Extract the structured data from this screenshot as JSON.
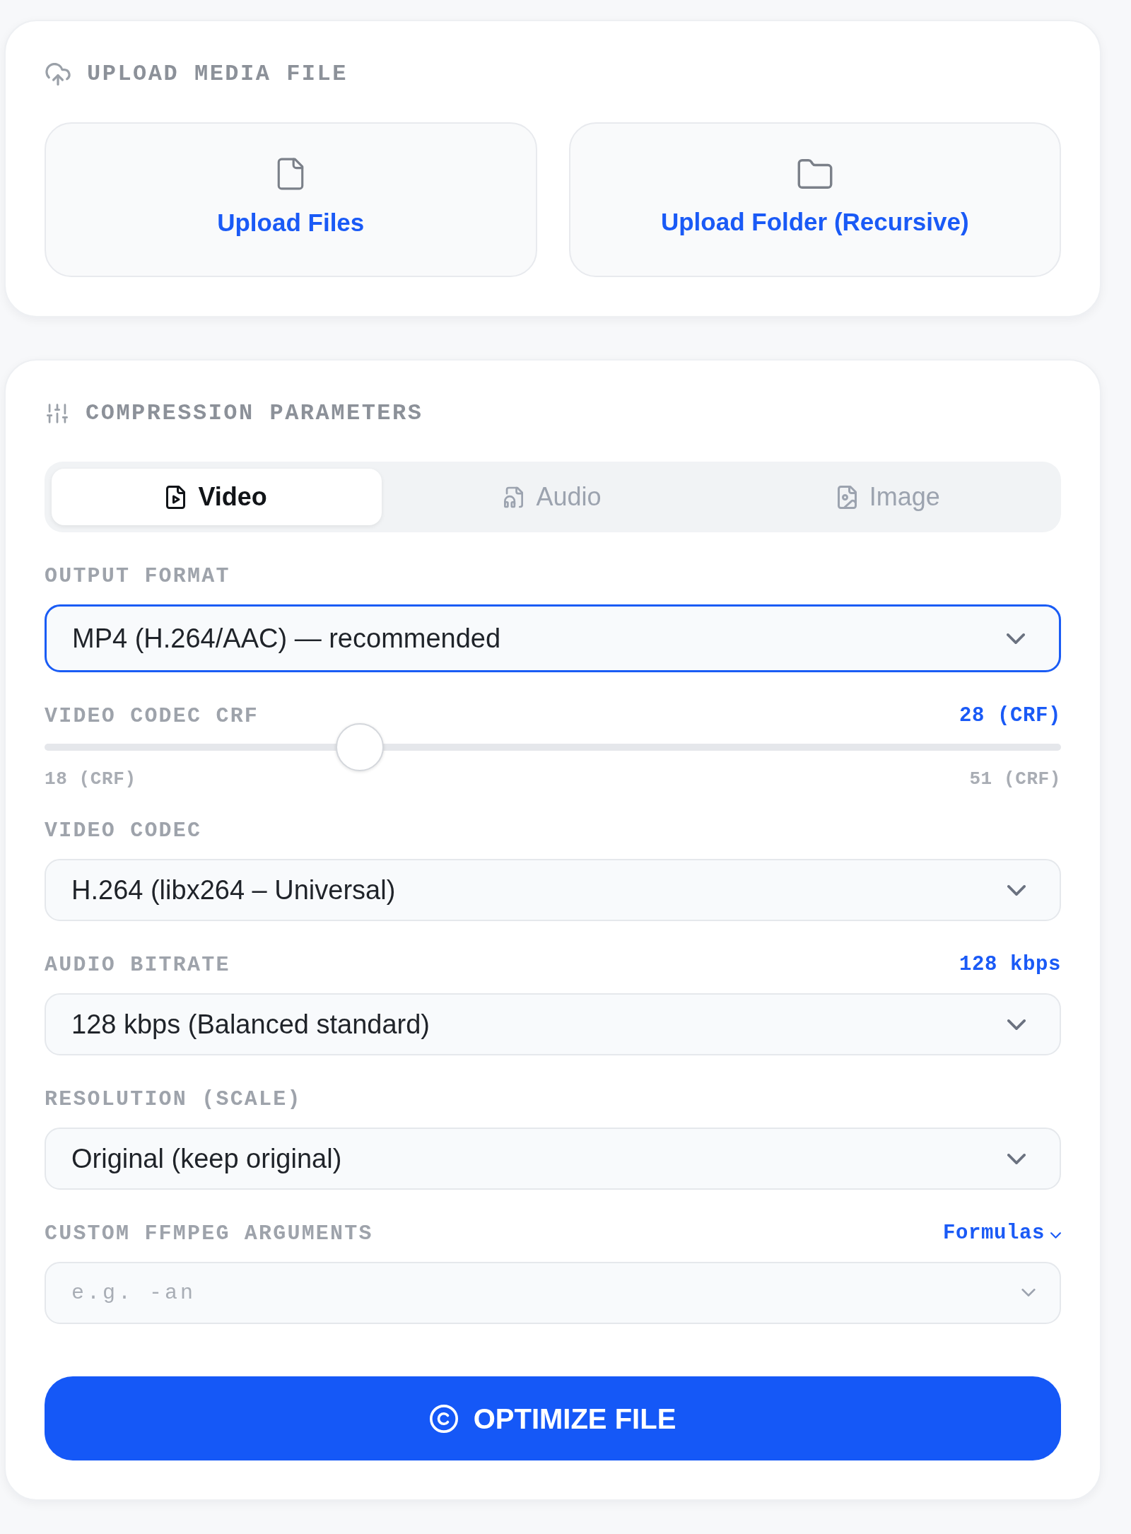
{
  "upload": {
    "title": "UPLOAD MEDIA FILE",
    "buttons": [
      {
        "kind": "files",
        "label": "Upload Files"
      },
      {
        "kind": "folder",
        "label": "Upload Folder (Recursive)"
      }
    ]
  },
  "compression": {
    "title": "COMPRESSION PARAMETERS",
    "tabs": [
      {
        "kind": "video",
        "label": "Video",
        "selected": true
      },
      {
        "kind": "audio",
        "label": "Audio",
        "selected": false
      },
      {
        "kind": "image",
        "label": "Image",
        "selected": false
      }
    ],
    "fields": [
      {
        "kind": "select",
        "label": "OUTPUT FORMAT",
        "value": "MP4 (H.264/AAC) — recommended",
        "focused": true
      },
      {
        "kind": "slider",
        "label": "VIDEO CODEC CRF",
        "reading": "28 (CRF)",
        "level": 0.31,
        "min_label": "18 (CRF)",
        "max_label": "51 (CRF)"
      },
      {
        "kind": "select",
        "label": "VIDEO CODEC",
        "value": "H.264 (libx264 – Universal)",
        "focused": false
      },
      {
        "kind": "select",
        "label": "AUDIO BITRATE",
        "reading": "128 kbps",
        "value": "128 kbps (Balanced standard)",
        "focused": false
      },
      {
        "kind": "select",
        "label": "RESOLUTION (SCALE)",
        "value": "Original (keep original)",
        "focused": false
      },
      {
        "kind": "input",
        "label": "CUSTOM FFMPEG ARGUMENTS",
        "link": "Formulas",
        "placeholder": "e.g. -an"
      }
    ],
    "submit": "OPTIMIZE FILE"
  }
}
